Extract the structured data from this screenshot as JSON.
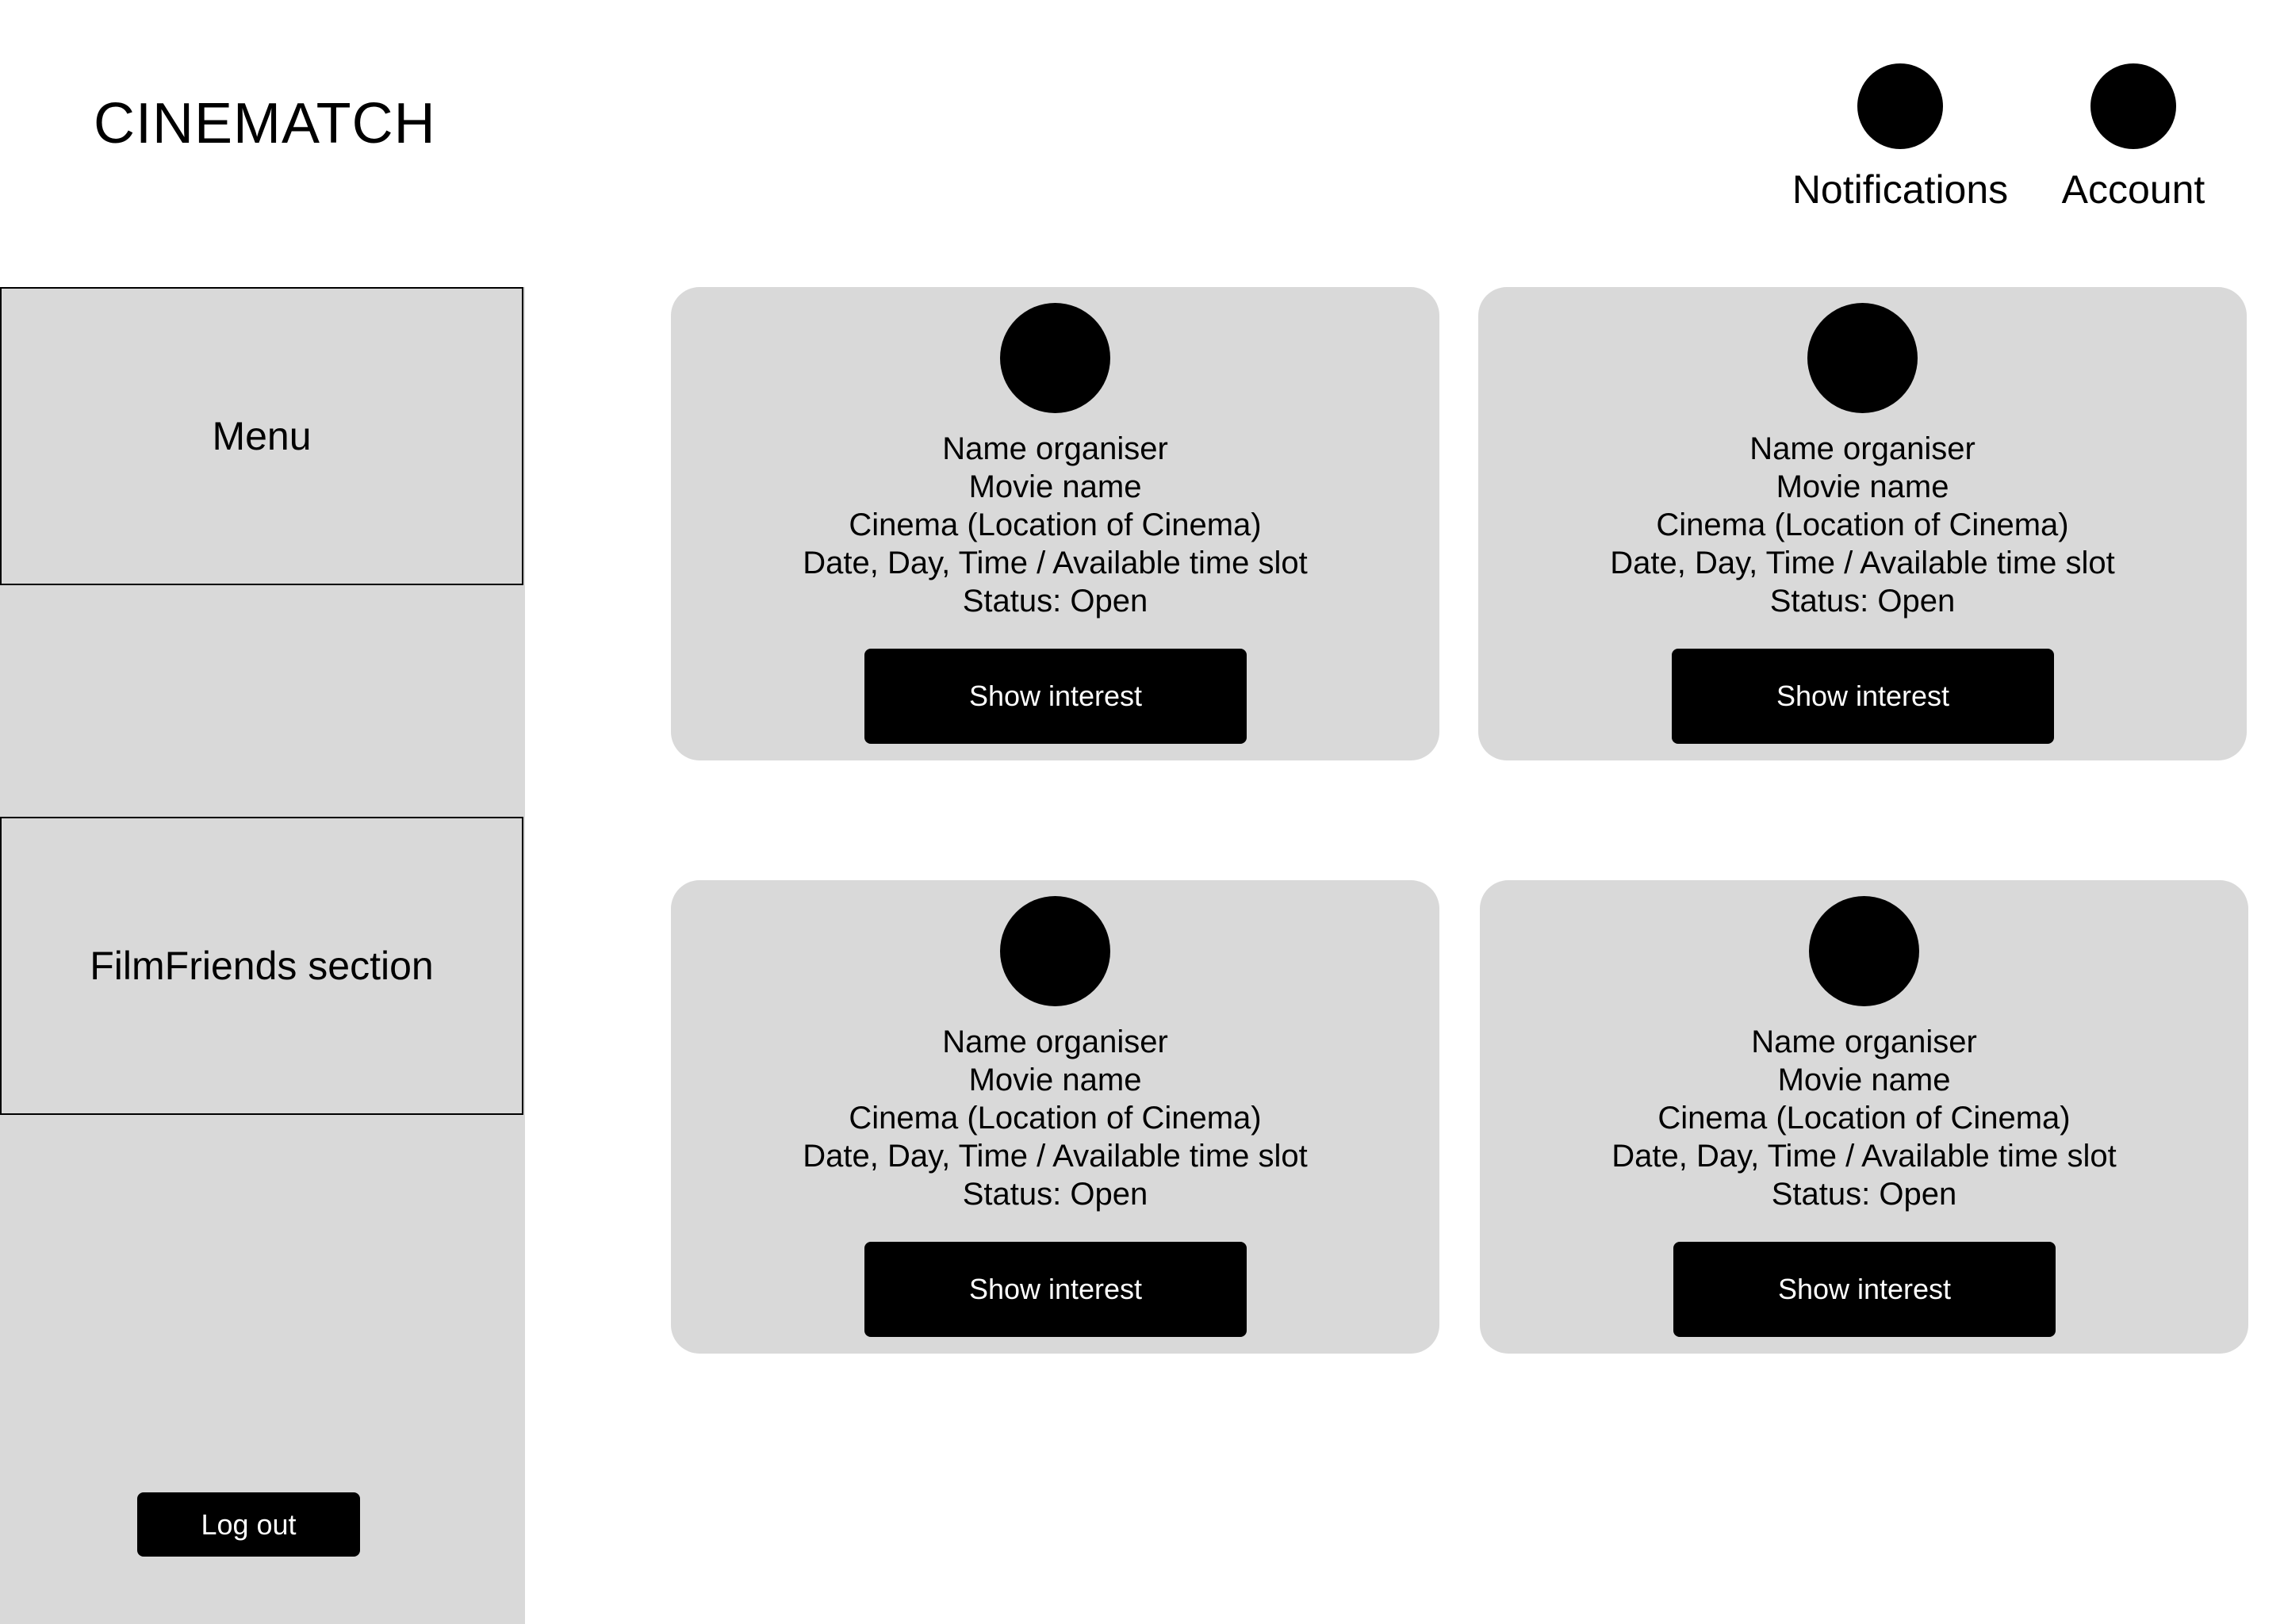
{
  "app": {
    "title": "CINEMATCH"
  },
  "header": {
    "notifications_label": "Notifications",
    "account_label": "Account"
  },
  "sidebar": {
    "menu_label": "Menu",
    "filmfriends_label": "FilmFriends section",
    "logout_label": "Log out"
  },
  "cards": [
    {
      "organiser": "Name organiser",
      "movie": "Movie name",
      "cinema": "Cinema (Location of Cinema)",
      "datetime": "Date, Day, Time / Available time slot",
      "status": "Status: Open",
      "button_label": "Show interest"
    },
    {
      "organiser": "Name organiser",
      "movie": "Movie name",
      "cinema": "Cinema (Location of Cinema)",
      "datetime": "Date, Day, Time / Available time slot",
      "status": "Status: Open",
      "button_label": "Show interest"
    },
    {
      "organiser": "Name organiser",
      "movie": "Movie name",
      "cinema": "Cinema (Location of Cinema)",
      "datetime": "Date, Day, Time / Available time slot",
      "status": "Status: Open",
      "button_label": "Show interest"
    },
    {
      "organiser": "Name organiser",
      "movie": "Movie name",
      "cinema": "Cinema (Location of Cinema)",
      "datetime": "Date, Day, Time / Available time slot",
      "status": "Status: Open",
      "button_label": "Show interest"
    }
  ],
  "colors": {
    "panel_gray": "#d9d9d9",
    "primary_black": "#000000",
    "text_white": "#ffffff"
  },
  "icons": {
    "notifications": "notifications-icon",
    "account": "account-icon",
    "organiser_avatar": "avatar"
  }
}
